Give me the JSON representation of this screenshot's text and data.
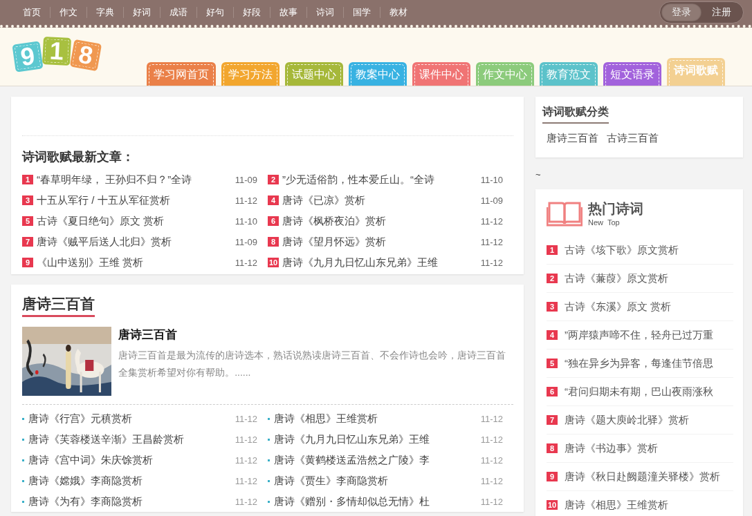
{
  "top_nav": {
    "items": [
      "首页",
      "作文",
      "字典",
      "好词",
      "成语",
      "好句",
      "好段",
      "故事",
      "诗词",
      "国学",
      "教材"
    ],
    "account": [
      {
        "label": "登录",
        "selected": true
      },
      {
        "label": "注册",
        "selected": false
      }
    ]
  },
  "logo": [
    {
      "char": "9",
      "color": "#5cc8d0"
    },
    {
      "char": "1",
      "color": "#a8c040"
    },
    {
      "char": "8",
      "color": "#f09850"
    }
  ],
  "tabs": [
    {
      "label": "学习网首页",
      "color": "#ea8048",
      "selected": false
    },
    {
      "label": "学习方法",
      "color": "#f2a62e",
      "selected": false
    },
    {
      "label": "试题中心",
      "color": "#a6b83a",
      "selected": false
    },
    {
      "label": "教案中心",
      "color": "#38b2e2",
      "selected": false
    },
    {
      "label": "课件中心",
      "color": "#f07474",
      "selected": false
    },
    {
      "label": "作文中心",
      "color": "#8ccb7c",
      "selected": false
    },
    {
      "label": "教育范文",
      "color": "#5cc2ca",
      "selected": false
    },
    {
      "label": "短文语录",
      "color": "#a262dc",
      "selected": false
    },
    {
      "label": "诗词歌赋",
      "color": "#f2cc88",
      "selected": true
    }
  ],
  "latest": {
    "title": "诗词歌赋最新文章：",
    "items": [
      {
        "rank": "1",
        "title": "“春草明年绿， 王孙归不归？”全诗",
        "date": "11-09"
      },
      {
        "rank": "2",
        "title": "”少无适俗韵，性本爱丘山。“全诗",
        "date": "11-10"
      },
      {
        "rank": "3",
        "title": "十五从军行 / 十五从军征赏析",
        "date": "11-12"
      },
      {
        "rank": "4",
        "title": "唐诗《已凉》赏析",
        "date": "11-09"
      },
      {
        "rank": "5",
        "title": "古诗《夏日绝句》原文 赏析",
        "date": "11-10"
      },
      {
        "rank": "6",
        "title": "唐诗《枫桥夜泊》赏析",
        "date": "11-12"
      },
      {
        "rank": "7",
        "title": "唐诗《贼平后送人北归》赏析",
        "date": "11-09"
      },
      {
        "rank": "8",
        "title": "唐诗《望月怀远》赏析",
        "date": "11-12"
      },
      {
        "rank": "9",
        "title": "《山中送别》王维 赏析",
        "date": "11-12"
      },
      {
        "rank": "10",
        "title": "唐诗《九月九日忆山东兄弟》王维",
        "date": "11-12"
      }
    ]
  },
  "tang": {
    "title": "唐诗三百首",
    "feature": {
      "title": "唐诗三百首",
      "summary": "唐诗三百首是最为流传的唐诗选本，熟话说熟读唐诗三百首、不会作诗也会吟，唐诗三百首全集赏析希望对你有帮助。......"
    },
    "items": [
      {
        "title": "唐诗《行宫》元稹赏析",
        "date": "11-12"
      },
      {
        "title": "唐诗《相思》王维赏析",
        "date": "11-12"
      },
      {
        "title": "唐诗《芙蓉楼送辛渐》王昌龄赏析",
        "date": "11-12"
      },
      {
        "title": "唐诗《九月九日忆山东兄弟》王维",
        "date": "11-12"
      },
      {
        "title": "唐诗《宫中词》朱庆馀赏析",
        "date": "11-12"
      },
      {
        "title": "唐诗《黄鹤楼送孟浩然之广陵》李",
        "date": "11-12"
      },
      {
        "title": "唐诗《嫦娥》李商隐赏析",
        "date": "11-12"
      },
      {
        "title": "唐诗《贾生》李商隐赏析",
        "date": "11-12"
      },
      {
        "title": "唐诗《为有》李商隐赏析",
        "date": "11-12"
      },
      {
        "title": "唐诗《赠别・多情却似总无情》杜",
        "date": "11-12"
      }
    ]
  },
  "category": {
    "title": "诗词歌赋分类",
    "links": [
      "唐诗三百首",
      "古诗三百首"
    ]
  },
  "tilde": "~",
  "hot": {
    "title": "热门诗词",
    "subtitle": "New  Top",
    "items": [
      {
        "rank": "1",
        "title": "古诗《垓下歌》原文赏析"
      },
      {
        "rank": "2",
        "title": "古诗《蒹葭》原文赏析"
      },
      {
        "rank": "3",
        "title": "古诗《东溪》原文 赏析"
      },
      {
        "rank": "4",
        "title": "”两岸猿声啼不住，轻舟已过万重"
      },
      {
        "rank": "5",
        "title": "“独在异乡为异客，每逢佳节倍思"
      },
      {
        "rank": "6",
        "title": "“君问归期未有期，巴山夜雨涨秋"
      },
      {
        "rank": "7",
        "title": "唐诗《题大庾岭北驿》赏析"
      },
      {
        "rank": "8",
        "title": "唐诗《书边事》赏析"
      },
      {
        "rank": "9",
        "title": "唐诗《秋日赴阙题潼关驿楼》赏析"
      },
      {
        "rank": "10",
        "title": "唐诗《相思》王维赏析"
      }
    ]
  }
}
